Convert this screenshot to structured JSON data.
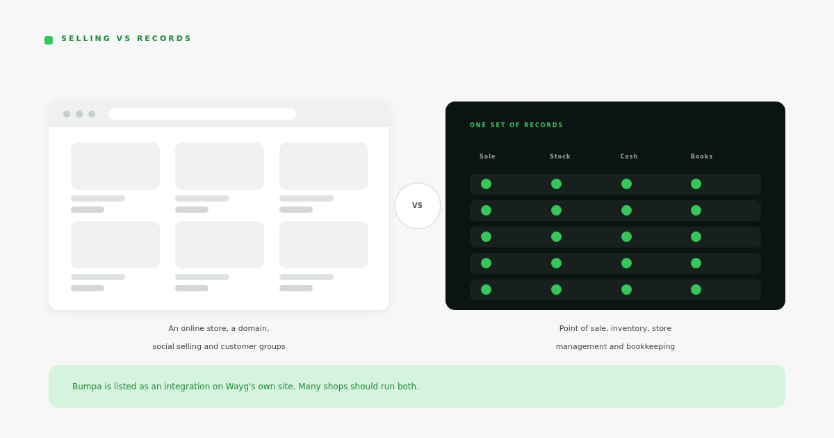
{
  "header": {
    "title": "SELLING VS RECORDS"
  },
  "store_panel": {
    "products": [
      {
        "kind": "placeholder"
      },
      {
        "kind": "placeholder"
      },
      {
        "kind": "placeholder"
      },
      {
        "kind": "placeholder"
      },
      {
        "kind": "placeholder"
      },
      {
        "kind": "placeholder"
      }
    ],
    "caption": [
      "An online store, a domain,",
      "social selling and customer groups"
    ]
  },
  "versus": "VS",
  "records_panel": {
    "title": "ONE SET OF RECORDS",
    "columns": [
      "Sale",
      "Stock",
      "Cash",
      "Books"
    ],
    "rows": [
      {
        "checks": [
          true,
          true,
          true,
          true
        ]
      },
      {
        "checks": [
          true,
          true,
          true,
          true
        ]
      },
      {
        "checks": [
          true,
          true,
          true,
          true
        ]
      },
      {
        "checks": [
          true,
          true,
          true,
          true
        ]
      },
      {
        "checks": [
          true,
          true,
          true,
          true
        ]
      }
    ],
    "caption": [
      "Point of sale, inventory, store",
      "management and bookkeeping"
    ]
  },
  "note": "Bumpa is listed as an integration on Wayg's own site. Many shops should run both."
}
